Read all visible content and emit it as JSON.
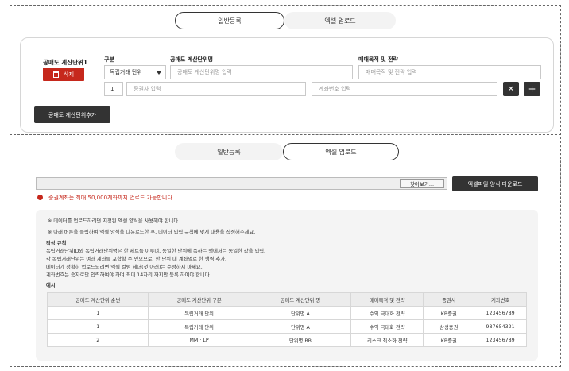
{
  "top": {
    "tabs": [
      "일반등록",
      "엑셀 업로드"
    ],
    "unit_title": "공매도 계산단위1",
    "delete_label": "삭제",
    "labels": {
      "category": "구분",
      "unit_name": "공매도 계산단위명",
      "purpose": "매매목적 및 전략"
    },
    "category_value": "독립거래 단위",
    "unit_name_placeholder": "공매도 계산단위명 입력",
    "purpose_placeholder": "매매목적 및 전략 입력",
    "row_number": "1",
    "broker_placeholder": "증권사 입력",
    "account_placeholder": "계좌번호 입력",
    "remove_icon": "✕",
    "add_icon": "+",
    "add_unit_label": "공매도 계산단위추가"
  },
  "bottom": {
    "tabs": [
      "일반등록",
      "엑셀 업로드"
    ],
    "browse_label": "찾아보기...",
    "download_label": "엑셀파일 양식 다운로드",
    "warning": "증권계좌는 최대 50,000계좌까지 업로드 가능합니다.",
    "notes": [
      "※ 데이터를 업로드하려면 지정된 엑셀 양식을 사용해야 합니다.",
      "※ 아래 버튼을 클릭하여 엑셀 양식을 다운로드한 후, 데이터 입력 규칙에 맞게 내용을 작성해주세요."
    ],
    "rules_title": "작성 규칙",
    "rules": [
      "독립거래단위ID와 독립거래단위명은 한 세트를 이루며, 동일한 단위에 속하는 행에서는 동일한 값을 입력.",
      "각 독립거래단위는 여러 계좌를 포함할 수 있으므로, 한 단위 내 계좌별로 한 행씩 추가.",
      "데이터가 정확히 업로드되려면 엑셀 컬럼 헤더(첫 아래)는 수정하지 마세요.",
      "계좌번호는 숫자로만 입력하여야 하며 최대 14자리 까지만 등록 하여야 합니다."
    ],
    "example_title": "예시",
    "table": {
      "headers": [
        "공매도 계산단위 순번",
        "공매도 계산단위 구분",
        "공매도 계산단위 명",
        "매매목적 및 전략",
        "증권사",
        "계좌번호"
      ],
      "rows": [
        [
          "1",
          "독립거래 단위",
          "단위명 A",
          "수익 극대화 전략",
          "KB증권",
          "123456789"
        ],
        [
          "1",
          "독립거래 단위",
          "단위명 A",
          "수익 극대화 전략",
          "삼성증권",
          "987654321"
        ],
        [
          "2",
          "MM · LP",
          "단위명 BB",
          "리스크 최소화 전략",
          "KB증권",
          "123456789"
        ]
      ]
    }
  },
  "colors": {
    "danger": "#c6281c",
    "dark": "#333333"
  }
}
